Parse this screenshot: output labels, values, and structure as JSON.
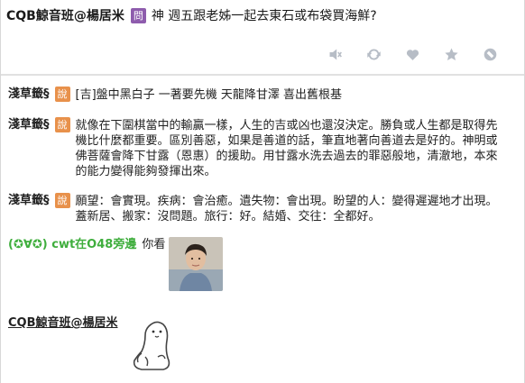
{
  "post": {
    "poster": "CQB鯨音班@楊居米",
    "tag": "問",
    "title": "神 週五跟老姊一起去東石或布袋買海鮮?"
  },
  "actions": [
    {
      "name": "mute-icon"
    },
    {
      "name": "refresh-icon"
    },
    {
      "name": "heart-icon"
    },
    {
      "name": "star-icon"
    },
    {
      "name": "block-icon"
    }
  ],
  "comments": [
    {
      "author": "淺草籤§",
      "badge": "說",
      "text": "[吉]盤中黑白子 一著要先機 天龍降甘澤 喜出舊根基"
    },
    {
      "author": "淺草籤§",
      "badge": "說",
      "text": "就像在下圍棋當中的輸贏一樣，人生的吉或凶也還沒決定。勝負或人生都是取得先機比什麼都重要。區別善惡，如果是善道的話，筆直地著向善道去是好的。神明或佛菩薩會降下甘露（恩惠）的援助。用甘露水洗去過去的罪惡般地，清澈地，本來的能力變得能夠發揮出來。"
    },
    {
      "author": "淺草籤§",
      "badge": "說",
      "text": "願望：會實現。疾病：會治癒。遺失物：會出現。盼望的人：變得遲遲地才出現。蓋新居、搬家：沒問題。旅行：好。結婚、交往：全都好。"
    },
    {
      "author": "(✪∀✪) cwt在O48旁邊",
      "text": "你看"
    },
    {
      "author": "CQB鯨音班@楊居米"
    }
  ],
  "colors": {
    "ask_tag": "#8e5cad",
    "say_badge": "#e8914b",
    "green_user": "#3fae3d",
    "icon": "#b7bdc6"
  }
}
